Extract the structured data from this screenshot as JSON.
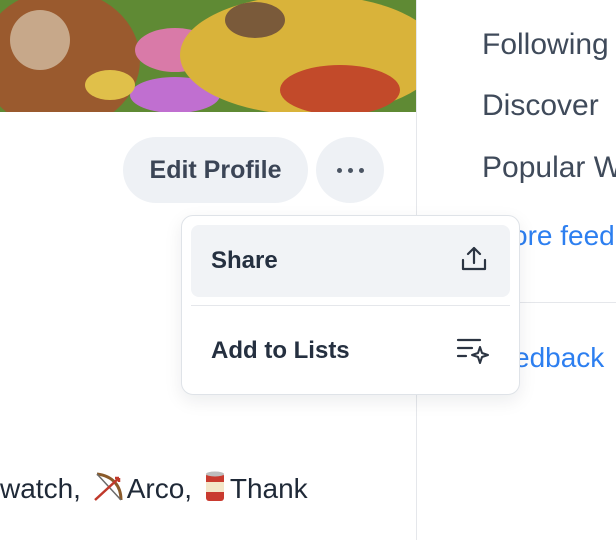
{
  "profile": {
    "edit_button": "Edit Profile",
    "more_button_icon": "ellipsis-icon"
  },
  "menu": {
    "items": [
      {
        "label": "Share",
        "icon": "share-upload-icon"
      },
      {
        "label": "Add to Lists",
        "icon": "list-sparkle-icon"
      }
    ]
  },
  "right_nav": {
    "items": [
      "Following",
      "Discover",
      "Popular W"
    ],
    "more_feeds_fragment": "ore feed",
    "feedback_fragment": "edback"
  },
  "bottom_text": {
    "part1": "watch, ",
    "part2_icon": "bow-arrow-icon",
    "part2": "Arco, ",
    "part3_icon": "can-icon",
    "part3": "Thank"
  },
  "colors": {
    "link_blue": "#2d7ff0",
    "muted_text": "#3f4a5a",
    "button_bg": "#eef1f5"
  }
}
